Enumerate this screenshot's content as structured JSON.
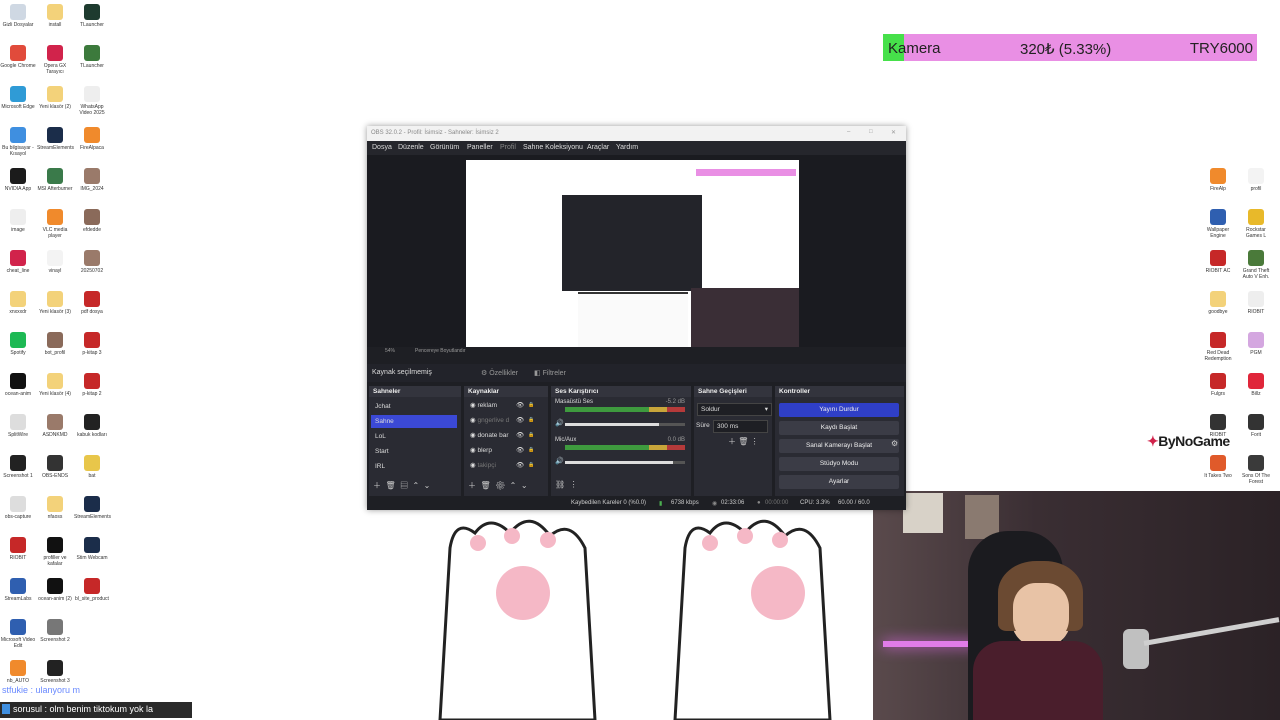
{
  "banner": {
    "label": "Kamera",
    "amount": "320₺ (5.33%)",
    "goal": "TRY6000",
    "accent_color": "#46e04a",
    "bar_color": "#e98fe4"
  },
  "desktop_left": [
    {
      "label": "Gizli Dosyalar",
      "color": "#cfd8e3"
    },
    {
      "label": "install",
      "color": "#f3d27a"
    },
    {
      "label": "TLauncher",
      "color": "#1e3b2f"
    },
    {
      "label": "Google Chrome",
      "color": "#e14b3b"
    },
    {
      "label": "Opera GX Tarayıcı",
      "color": "#d1234b"
    },
    {
      "label": "TLauncher",
      "color": "#3c7a3c"
    },
    {
      "label": "Microsoft Edge",
      "color": "#2f9bd6"
    },
    {
      "label": "Yeni klasör (2)",
      "color": "#f3d27a"
    },
    {
      "label": "WhatsApp Video 2025",
      "color": "#eeeeee"
    },
    {
      "label": "Bu bilgisayar - Kısayol",
      "color": "#3f8fe0"
    },
    {
      "label": "StreamElements",
      "color": "#1b2d4a"
    },
    {
      "label": "FireAlpaca",
      "color": "#f08a2c"
    },
    {
      "label": "NVIDIA App",
      "color": "#1b1b1b"
    },
    {
      "label": "MSI Afterburner",
      "color": "#3a7a4a"
    },
    {
      "label": "IMG_2024",
      "color": "#9a7a6a"
    },
    {
      "label": "image",
      "color": "#eeeeee"
    },
    {
      "label": "VLC media player",
      "color": "#f08a2c"
    },
    {
      "label": "efdedde",
      "color": "#8a6a5a"
    },
    {
      "label": "cheat_line",
      "color": "#d1234b"
    },
    {
      "label": "vinayl",
      "color": "#f3f3f3"
    },
    {
      "label": "20250702",
      "color": "#9a7a6a"
    },
    {
      "label": "xnxxxdr",
      "color": "#f3d27a"
    },
    {
      "label": "Yeni klasör (3)",
      "color": "#f3d27a"
    },
    {
      "label": "pdf dosya",
      "color": "#c62828"
    },
    {
      "label": "Spotify",
      "color": "#1db954"
    },
    {
      "label": "bot_profil",
      "color": "#8a6a5a"
    },
    {
      "label": "p-kitap 3",
      "color": "#c62828"
    },
    {
      "label": "ocean-anim",
      "color": "#111111"
    },
    {
      "label": "Yeni klasör (4)",
      "color": "#f3d27a"
    },
    {
      "label": "p-kitap 2",
      "color": "#c62828"
    },
    {
      "label": "SplitWire",
      "color": "#dddddd"
    },
    {
      "label": "ASDNKMD",
      "color": "#9a7a6a"
    },
    {
      "label": "kabuk kodları",
      "color": "#222222"
    },
    {
      "label": "Screenshot 1",
      "color": "#222222"
    },
    {
      "label": "OBS-ENDS",
      "color": "#333333"
    },
    {
      "label": "bat",
      "color": "#e8c64a"
    },
    {
      "label": "obs-capture",
      "color": "#dddddd"
    },
    {
      "label": "nfaoss",
      "color": "#f3d27a"
    },
    {
      "label": "StreamElements",
      "color": "#1b2d4a"
    },
    {
      "label": "RIOBIT",
      "color": "#c62828"
    },
    {
      "label": "profiller ve kafalar",
      "color": "#111111"
    },
    {
      "label": "Stim Webcam",
      "color": "#1b2d4a"
    },
    {
      "label": "StreamLabs",
      "color": "#2f5fb0"
    },
    {
      "label": "ocean-anim (2)",
      "color": "#111111"
    },
    {
      "label": "bl_site_product",
      "color": "#c62828"
    },
    {
      "label": "Microsoft Video Edit",
      "color": "#2f5fb0"
    },
    {
      "label": "Screenshot 2",
      "color": "#777777"
    },
    {
      "label": "",
      "color": "#ffffff"
    },
    {
      "label": "nb_AUTO",
      "color": "#f08a2c"
    },
    {
      "label": "Screenshot 3",
      "color": "#222222"
    },
    {
      "label": "",
      "color": "#ffffff"
    }
  ],
  "desktop_right": [
    {
      "label": "FireAlp",
      "color": "#f08a2c"
    },
    {
      "label": "profil",
      "color": "#f3f3f3"
    },
    {
      "label": "Wallpaper Engine",
      "color": "#2f5fb0"
    },
    {
      "label": "Rockstar Games L",
      "color": "#e8b92a"
    },
    {
      "label": "RIOBIT AC",
      "color": "#c62828"
    },
    {
      "label": "Grand Theft Auto V Enh.",
      "color": "#4a7a3a"
    },
    {
      "label": "goodbye",
      "color": "#f3d27a"
    },
    {
      "label": "RIOBIT",
      "color": "#eeeeee"
    },
    {
      "label": "Red Dead Redemption",
      "color": "#c62828"
    },
    {
      "label": "PGM",
      "color": "#d4a7e0"
    },
    {
      "label": "Fulgrs",
      "color": "#c62828"
    },
    {
      "label": "Billz",
      "color": "#e0263a"
    },
    {
      "label": "RIOBIT",
      "color": "#333333"
    },
    {
      "label": "Forit",
      "color": "#333333"
    },
    {
      "label": "It Takes Two",
      "color": "#e05a2a"
    },
    {
      "label": "Sons Of The Forest",
      "color": "#3a3a3a"
    }
  ],
  "bynogame": "ByNoGame",
  "obs": {
    "title": "OBS 32.0.2 - Profil: İsimsiz - Sahneler: İsimsiz 2",
    "menu": [
      "Dosya",
      "Düzenle",
      "Görünüm",
      "Paneller",
      "Profil",
      "Sahne Koleksiyonu",
      "Araçlar",
      "Yardım"
    ],
    "zoom": "54%",
    "fit": "Pencereye Boyutlandır",
    "no_source": "Kaynak seçilmemiş",
    "properties": "Özellikler",
    "filters": "Filtreler",
    "scenes_title": "Sahneler",
    "scenes": [
      "Jchat",
      "Sahne",
      "LoL",
      "Start",
      "IRL"
    ],
    "sources_title": "Kaynaklar",
    "sources": [
      "reklam",
      "gngerlive d",
      "donate bar",
      "blerp",
      "takipçi"
    ],
    "mixer_title": "Ses Karıştırıcı",
    "mixer": [
      {
        "name": "Masaüstü Ses",
        "db": "-5.2 dB",
        "level": 0.78
      },
      {
        "name": "Mic/Aux",
        "db": "0.0 dB",
        "level": 0.9
      }
    ],
    "transitions_title": "Sahne Geçişleri",
    "transition": "Soldur",
    "duration_label": "Süre",
    "duration": "300 ms",
    "controls_title": "Kontroller",
    "controls": [
      "Yayını Durdur",
      "Kaydı Başlat",
      "Sanal Kamerayı Başlat",
      "Stüdyo Modu",
      "Ayarlar"
    ],
    "status": {
      "dropped": "Kaybedilen Kareler 0 (%0.0)",
      "bitrate": "6738 kbps",
      "live": "02:33:06",
      "rec": "00:00:00",
      "cpu": "CPU: 3.3%",
      "fps": "60.00 / 60.0"
    }
  },
  "ticker": {
    "line1": "stfukie : ulanyoru m",
    "line2": "sorusul : olm benim tiktokum yok la"
  },
  "colors": {
    "active_blue": "#2f3fc7",
    "scene_selected": "#3b49d6"
  }
}
